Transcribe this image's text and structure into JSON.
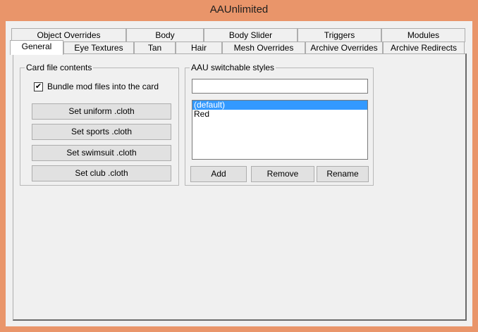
{
  "window": {
    "title": "AAUnlimited"
  },
  "tabs": {
    "back_row": [
      {
        "label": "Object Overrides"
      },
      {
        "label": "Body"
      },
      {
        "label": "Body Slider"
      },
      {
        "label": "Triggers"
      },
      {
        "label": "Modules"
      }
    ],
    "front_row": [
      {
        "label": "General",
        "selected": true
      },
      {
        "label": "Eye Textures"
      },
      {
        "label": "Tan"
      },
      {
        "label": "Hair"
      },
      {
        "label": "Mesh Overrides"
      },
      {
        "label": "Archive Overrides"
      },
      {
        "label": "Archive Redirects"
      }
    ]
  },
  "card_file": {
    "title": "Card file contents",
    "bundle_checkbox": {
      "label": "Bundle mod files into the card",
      "checked": true,
      "glyph": "✔"
    },
    "buttons": [
      {
        "label": "Set uniform .cloth"
      },
      {
        "label": "Set sports .cloth"
      },
      {
        "label": "Set swimsuit .cloth"
      },
      {
        "label": "Set club .cloth"
      }
    ]
  },
  "styles": {
    "title": "AAU switchable styles",
    "name_input": {
      "value": "",
      "placeholder": ""
    },
    "list": [
      {
        "label": "(default)",
        "selected": true
      },
      {
        "label": "Red",
        "selected": false
      }
    ],
    "buttons": {
      "add": "Add",
      "remove": "Remove",
      "rename": "Rename"
    }
  },
  "colors": {
    "frame": "#e9956a",
    "client": "#f0f0f0",
    "selection": "#3399ff"
  }
}
